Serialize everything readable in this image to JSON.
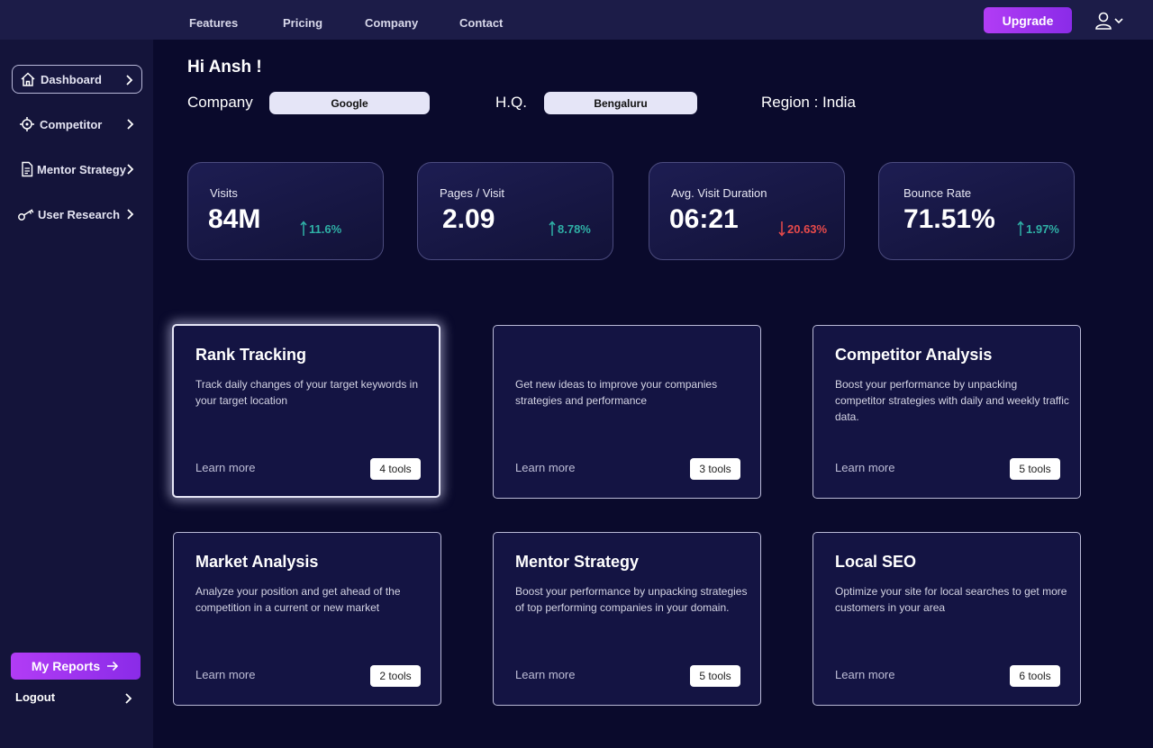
{
  "nav": {
    "links": [
      "Features",
      "Pricing",
      "Company",
      "Contact"
    ],
    "upgrade_label": "Upgrade",
    "user_icon": "user-icon",
    "accent_color": "#a435f0"
  },
  "sidebar": {
    "items": [
      {
        "label": "Dashboard",
        "icon": "home-icon",
        "active": true
      },
      {
        "label": "Competitor",
        "icon": "crosshair-icon",
        "active": false
      },
      {
        "label": "Mentor Strategy",
        "icon": "document-icon",
        "active": false
      },
      {
        "label": "User Research",
        "icon": "key-icon",
        "active": false
      }
    ],
    "reports_label": "My Reports",
    "logout_label": "Logout"
  },
  "header": {
    "greeting": "Hi Ansh !",
    "company_label": "Company",
    "company_value": "Google",
    "hq_label": "H.Q.",
    "hq_value": "Bengaluru",
    "region_text": "Region : India"
  },
  "stats": [
    {
      "label": "Visits",
      "value": "84M",
      "change": "11.6%",
      "direction": "up"
    },
    {
      "label": "Pages / Visit",
      "value": "2.09",
      "change": "8.78%",
      "direction": "up"
    },
    {
      "label": "Avg. Visit Duration",
      "value": "06:21",
      "change": "20.63%",
      "direction": "down"
    },
    {
      "label": "Bounce Rate",
      "value": "71.51%",
      "change": "1.97%",
      "direction": "up"
    }
  ],
  "cards": [
    {
      "title": "Rank Tracking",
      "desc": "Track daily changes of your target keywords in your target location",
      "more": "Learn more",
      "tools": "4 tools"
    },
    {
      "title": "",
      "desc": "Get new ideas to improve your companies strategies and performance",
      "more": "Learn more",
      "tools": "3 tools"
    },
    {
      "title": "Competitor Analysis",
      "desc": "Boost your performance by unpacking competitor strategies with daily and weekly traffic data.",
      "more": "Learn more",
      "tools": "5 tools"
    },
    {
      "title": "Market Analysis",
      "desc": "Analyze your position and get ahead of the competition in a current or new market",
      "more": "Learn more",
      "tools": "2 tools"
    },
    {
      "title": "Mentor Strategy",
      "desc": "Boost your performance by unpacking strategies of top performing companies in your domain.",
      "more": "Learn more",
      "tools": "5 tools"
    },
    {
      "title": "Local SEO",
      "desc": "Optimize your site for local searches to get more customers in your area",
      "more": "Learn more",
      "tools": "6 tools"
    }
  ]
}
